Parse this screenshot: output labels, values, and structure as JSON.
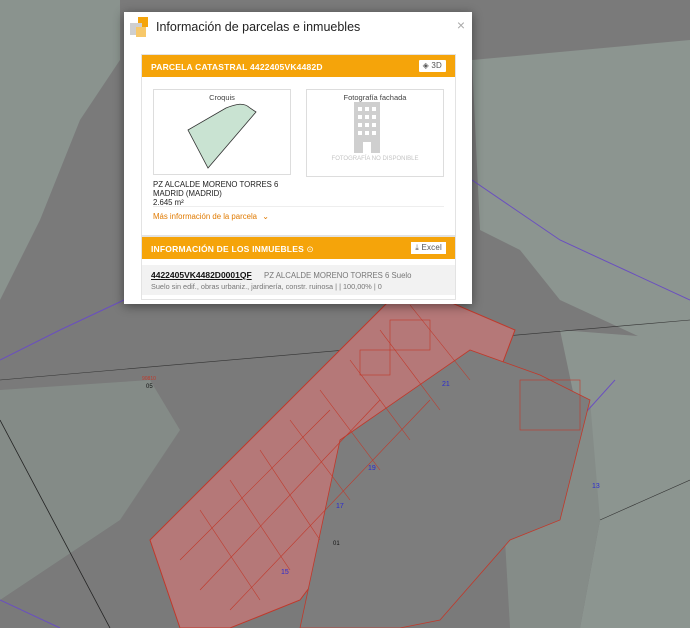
{
  "dialog": {
    "title": "Información de parcelas e inmuebles",
    "close_glyph": "×"
  },
  "parcela": {
    "header": "PARCELA CATASTRAL 4422405VK4482D",
    "btn_3d": "3D",
    "croquis_label": "Croquis",
    "foto_label": "Fotografía fachada",
    "foto_unavailable": "FOTOGRAFÍA NO DISPONIBLE",
    "address_line1": "PZ ALCALDE MORENO TORRES 6",
    "address_line2": "MADRID (MADRID)",
    "area": "2.645 m²",
    "more_link": "Más información de la parcela"
  },
  "inmuebles": {
    "header": "INFORMACIÓN DE LOS INMUEBLES",
    "excel_btn": "Excel",
    "rows": [
      {
        "ref": "4422405VK4482D0001QF",
        "address": "PZ ALCALDE MORENO TORRES 6 Suelo",
        "info": "Suelo sin edif., obras urbaniz., jardinería, constr. ruinosa  |   | 100,00%  |  0"
      }
    ]
  },
  "map": {
    "labels": [
      "90810",
      "05",
      "21",
      "19",
      "17",
      "15",
      "13",
      "01"
    ],
    "colors": {
      "background": "#7a7a7a",
      "parcel_other": "#8c9590",
      "building_fill": "#b57878",
      "building_line": "#c0392b",
      "boundary_purple": "#6a4fc0",
      "accent_orange": "#f5a40a"
    }
  }
}
